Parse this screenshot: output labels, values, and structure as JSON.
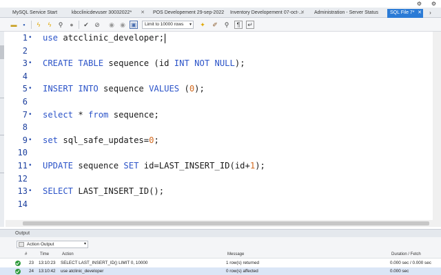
{
  "tabs": [
    {
      "label": "MySQL Service Start",
      "active": false
    },
    {
      "label": "kbcclinicdevuser 30032022*",
      "active": false
    },
    {
      "label": "POS Developement 29-sep-2022",
      "active": false
    },
    {
      "label": "Inventory Developement 07-oct-...",
      "active": false
    },
    {
      "label": "Administration - Server Status",
      "active": false
    },
    {
      "label": "SQL File 7*",
      "active": true
    }
  ],
  "toolbar": {
    "limit_label": "Limit to 10000 rows",
    "icons": [
      "folder-icon",
      "save-icon",
      "lightning-icon",
      "lightning-cursor-icon",
      "magnifier-icon",
      "stop-icon",
      "check-icon",
      "cancel-icon",
      "toggle-icon",
      "star-icon",
      "brush-icon",
      "search-icon",
      "paragraph-icon",
      "wrap-icon"
    ]
  },
  "editor": {
    "lines": [
      {
        "n": "1",
        "dot": true,
        "tokens": [
          [
            "kw",
            "use"
          ],
          [
            "t",
            " atcclinic_developer;"
          ]
        ],
        "cursor": true
      },
      {
        "n": "2",
        "dot": false,
        "tokens": []
      },
      {
        "n": "3",
        "dot": true,
        "tokens": [
          [
            "kw",
            "CREATE TABLE"
          ],
          [
            "t",
            " sequence (id "
          ],
          [
            "kw",
            "INT NOT NULL"
          ],
          [
            "t",
            ");"
          ]
        ]
      },
      {
        "n": "4",
        "dot": false,
        "tokens": []
      },
      {
        "n": "5",
        "dot": true,
        "tokens": [
          [
            "kw",
            "INSERT INTO"
          ],
          [
            "t",
            " sequence "
          ],
          [
            "kw",
            "VALUES"
          ],
          [
            "t",
            " ("
          ],
          [
            "num",
            "0"
          ],
          [
            "t",
            ");"
          ]
        ]
      },
      {
        "n": "6",
        "dot": false,
        "tokens": []
      },
      {
        "n": "7",
        "dot": true,
        "tokens": [
          [
            "kw",
            "select"
          ],
          [
            "t",
            " * "
          ],
          [
            "kw",
            "from"
          ],
          [
            "t",
            " sequence;"
          ]
        ]
      },
      {
        "n": "8",
        "dot": false,
        "tokens": []
      },
      {
        "n": "9",
        "dot": true,
        "tokens": [
          [
            "kw",
            "set"
          ],
          [
            "t",
            " sql_safe_updates="
          ],
          [
            "num",
            "0"
          ],
          [
            "t",
            ";"
          ]
        ]
      },
      {
        "n": "10",
        "dot": false,
        "tokens": []
      },
      {
        "n": "11",
        "dot": true,
        "tokens": [
          [
            "kw",
            "UPDATE"
          ],
          [
            "t",
            " sequence "
          ],
          [
            "kw",
            "SET"
          ],
          [
            "t",
            " id=LAST_INSERT_ID(id+"
          ],
          [
            "num",
            "1"
          ],
          [
            "t",
            ");"
          ]
        ]
      },
      {
        "n": "12",
        "dot": false,
        "tokens": []
      },
      {
        "n": "13",
        "dot": true,
        "tokens": [
          [
            "kw",
            "SELECT"
          ],
          [
            "t",
            " LAST_INSERT_ID();"
          ]
        ]
      },
      {
        "n": "14",
        "dot": false,
        "tokens": []
      }
    ]
  },
  "output": {
    "title": "Output",
    "mode": "Action Output",
    "columns": {
      "num": "#",
      "time": "Time",
      "action": "Action",
      "message": "Message",
      "duration": "Duration / Fetch"
    },
    "rows": [
      {
        "num": "23",
        "time": "13:10:23",
        "action": "SELECT LAST_INSERT_ID() LIMIT 0, 10000",
        "message": "1 row(s) returned",
        "duration": "0.000 sec / 0.000 sec",
        "selected": false
      },
      {
        "num": "24",
        "time": "13:10:42",
        "action": "use atclinic_developer",
        "message": "0 row(s) affected",
        "duration": "0.000 sec",
        "selected": true
      }
    ]
  },
  "colors": {
    "active_tab": "#2b7bd6",
    "keyword": "#2b53c8",
    "number": "#d2691e",
    "line_number": "#1c3f9e",
    "success": "#2e9a3c"
  }
}
